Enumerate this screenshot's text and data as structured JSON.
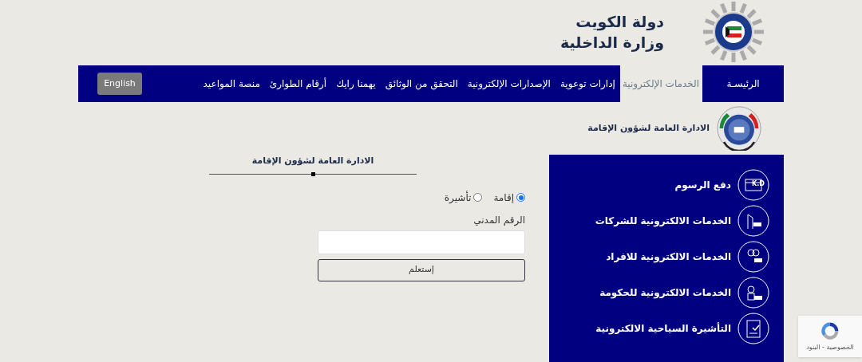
{
  "header": {
    "title_line1": "دولة الكويت",
    "title_line2": "وزارة الداخلية"
  },
  "nav": {
    "items": [
      {
        "label": "الرئيسـة",
        "selected": false,
        "boxed": true
      },
      {
        "label": "الخدمات الإلكترونية",
        "selected": true,
        "boxed": false
      },
      {
        "label": "إدارات توعوية",
        "selected": false,
        "boxed": false
      },
      {
        "label": "الإصدارات الإلكترونية",
        "selected": false,
        "boxed": false
      },
      {
        "label": "التحقق من الوثائق",
        "selected": false,
        "boxed": false
      },
      {
        "label": "يهمنا رايك",
        "selected": false,
        "boxed": false
      },
      {
        "label": "أرقام الطوارئ",
        "selected": false,
        "boxed": false
      },
      {
        "label": "منصة المواعيد",
        "selected": false,
        "boxed": false
      }
    ],
    "language_button": "English"
  },
  "section_title": "الادارة العامة لشؤون الإقامة",
  "form": {
    "heading": "الادارة العامة لشؤون الإقامة",
    "radios": [
      {
        "label": "إقامة",
        "selected": true
      },
      {
        "label": "تأشيرة",
        "selected": false
      }
    ],
    "field_label": "الرقم المدني",
    "submit": "إستعلم"
  },
  "services": [
    {
      "label": "دفع الرسوم",
      "kind": "payment",
      "icon_text": "K.D"
    },
    {
      "label": "الخدمات الالكترونية للشركات",
      "kind": "company"
    },
    {
      "label": "الخدمات الالكترونية للافراد",
      "kind": "individual"
    },
    {
      "label": "الخدمات الالكترونية للحكومة",
      "kind": "government"
    },
    {
      "label": "التأشيرة السياحية الالكترونية",
      "kind": "visa"
    }
  ],
  "recaptcha": {
    "text": "الخصوصية - البنود"
  }
}
